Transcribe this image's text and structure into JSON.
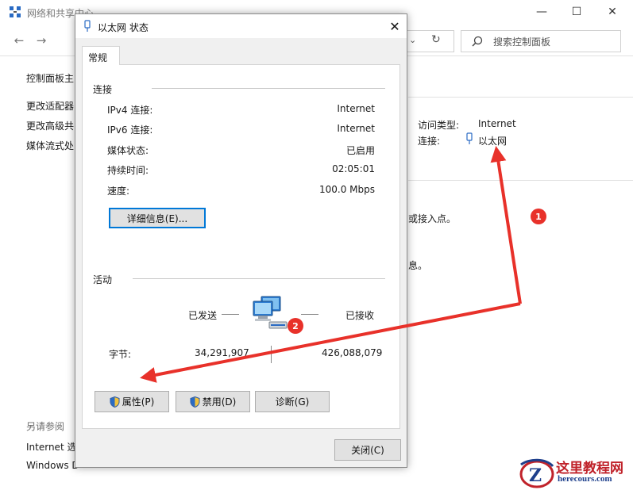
{
  "background_window": {
    "title": "网络和共享中心",
    "search_placeholder": "搜索控制面板",
    "sidebar": {
      "home": "控制面板主",
      "items": [
        "更改适配器",
        "更改高级共",
        "媒体流式处"
      ],
      "see_also_heading": "另请参阅",
      "see_also_items": [
        "Internet 选",
        "Windows D"
      ]
    },
    "right_panel": {
      "access_type_label": "访问类型:",
      "access_type_value": "Internet",
      "connection_label": "连接:",
      "connection_value": "以太网",
      "fragment_1": "或接入点。",
      "fragment_2": "息。"
    }
  },
  "dialog": {
    "title": "以太网 状态",
    "tab": "常规",
    "connection_section": "连接",
    "rows": [
      {
        "key": "IPv4 连接:",
        "value": "Internet"
      },
      {
        "key": "IPv6 连接:",
        "value": "Internet"
      },
      {
        "key": "媒体状态:",
        "value": "已启用"
      },
      {
        "key": "持续时间:",
        "value": "02:05:01"
      },
      {
        "key": "速度:",
        "value": "100.0 Mbps"
      }
    ],
    "details_button": "详细信息(E)...",
    "activity_section": "活动",
    "sent_label": "已发送",
    "received_label": "已接收",
    "bytes_label": "字节:",
    "bytes_sent": "34,291,907",
    "bytes_received": "426,088,079",
    "properties_button": "属性(P)",
    "disable_button": "禁用(D)",
    "diagnose_button": "诊断(G)",
    "close_button": "关闭(C)"
  },
  "annotations": {
    "badge_1": "1",
    "badge_2": "2",
    "arrow_color": "#e8312a"
  },
  "watermark": {
    "title": "这里教程网",
    "subtitle": "herecours.com",
    "logo_letter": "Z"
  }
}
